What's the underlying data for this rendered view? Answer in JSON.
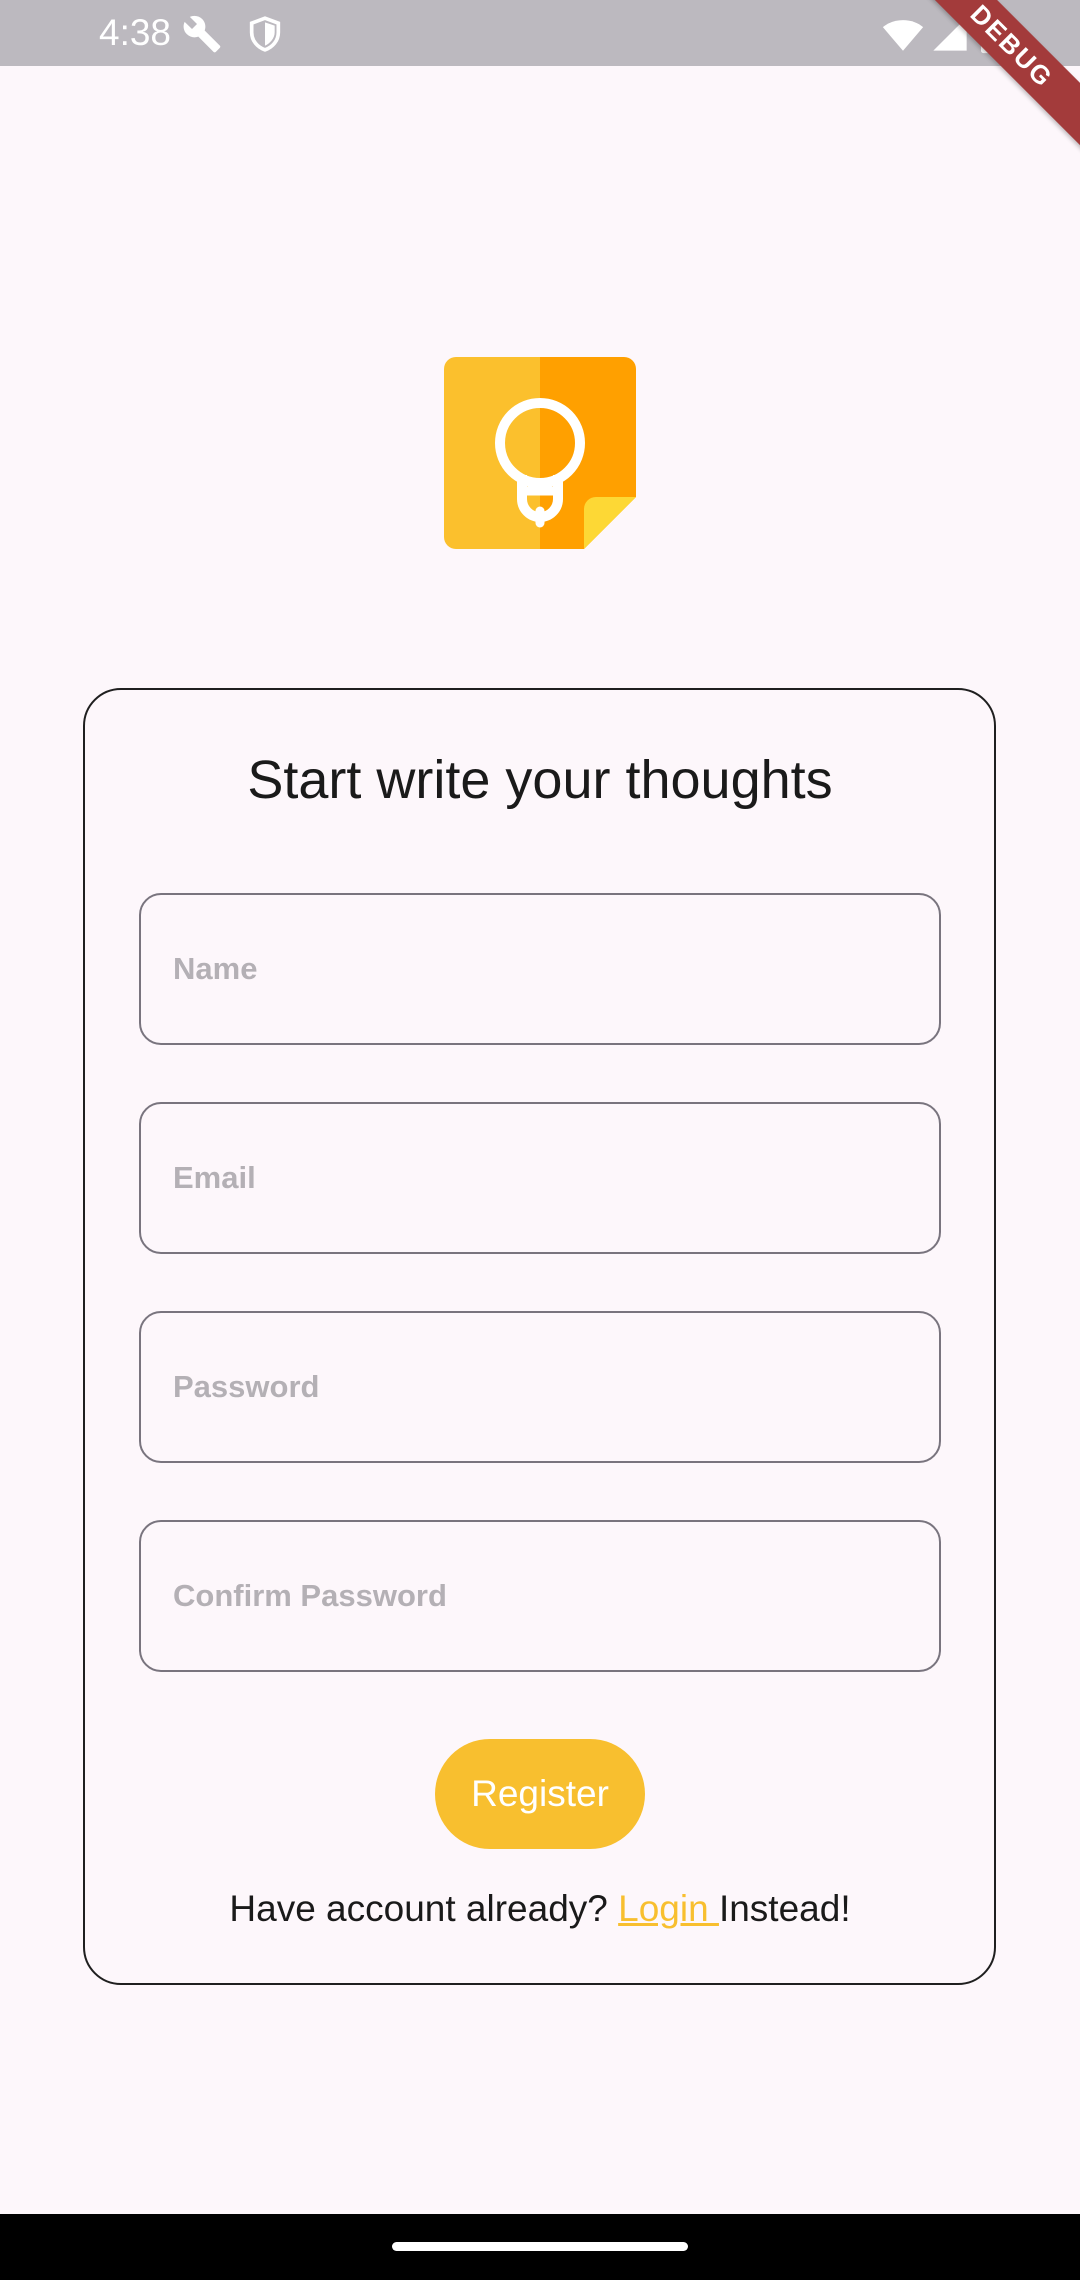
{
  "status_bar": {
    "time": "4:38",
    "left_icons": [
      "wrench-icon",
      "shield-icon"
    ],
    "right_icons": [
      "wifi-icon",
      "signal-icon",
      "battery-icon"
    ],
    "debug_banner": "DEBUG"
  },
  "logo": {
    "icon": "lightbulb-note-icon",
    "colors": {
      "left": "#fbc02d",
      "right": "#ffa000",
      "fold": "#fdd835",
      "bulb": "#ffffff"
    }
  },
  "form": {
    "title": "Start write your thoughts",
    "fields": {
      "name": {
        "placeholder": "Name",
        "value": ""
      },
      "email": {
        "placeholder": "Email",
        "value": ""
      },
      "password": {
        "placeholder": "Password",
        "value": ""
      },
      "confirm_password": {
        "placeholder": "Confirm Password",
        "value": ""
      }
    },
    "register_label": "Register",
    "footer": {
      "prefix": "Have account already? ",
      "link": "Login ",
      "suffix": "Instead!"
    }
  },
  "colors": {
    "accent": "#f8bf2f",
    "background": "#fdf7fb",
    "status_bar": "#bcb9bf",
    "field_border": "#79747e"
  }
}
